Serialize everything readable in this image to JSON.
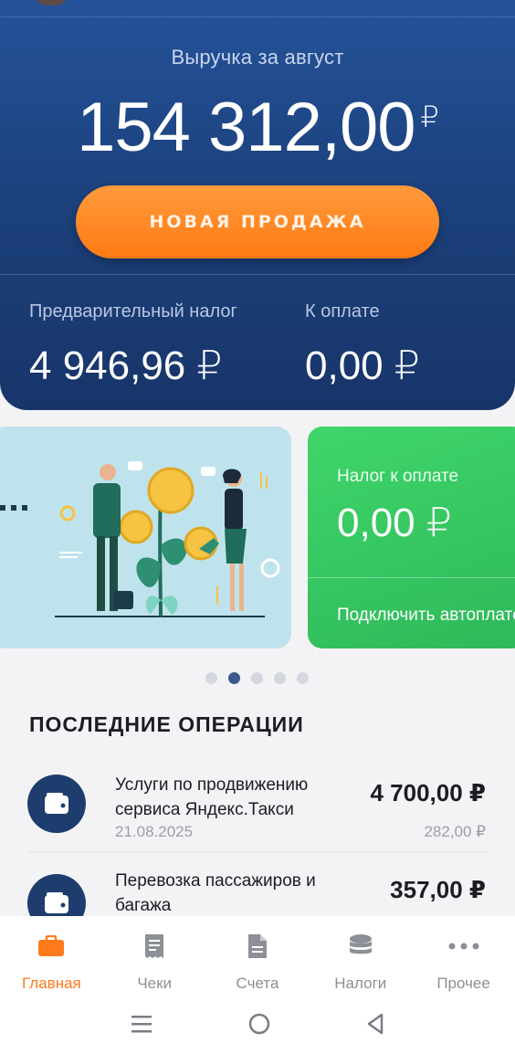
{
  "header": {
    "title": "Выручка за август",
    "amount": "154 312,00",
    "currency": "₽",
    "new_sale_button": "НОВАЯ ПРОДАЖА"
  },
  "taxes": {
    "preliminary_label": "Предварительный налог",
    "preliminary_value": "4 946,96 ₽",
    "to_pay_label": "К оплате",
    "to_pay_value": "0,00 ₽"
  },
  "carousel": {
    "green_card": {
      "label": "Налог к оплате",
      "amount": "0,00 ₽",
      "link": "Подключить автоплатёж"
    },
    "active_index": 1,
    "dot_count": 5
  },
  "operations": {
    "title": "ПОСЛЕДНИЕ ОПЕРАЦИИ",
    "items": [
      {
        "name": "Услуги по продвижению сервиса Яндекс.Такси",
        "date": "21.08.2025",
        "amount": "4 700,00 ₽",
        "tax": "282,00 ₽"
      },
      {
        "name": "Перевозка пассажиров и багажа",
        "amount": "357,00 ₽"
      }
    ]
  },
  "nav": [
    {
      "label": "Главная",
      "icon": "briefcase-icon",
      "active": true
    },
    {
      "label": "Чеки",
      "icon": "receipt-icon",
      "active": false
    },
    {
      "label": "Счета",
      "icon": "document-icon",
      "active": false
    },
    {
      "label": "Налоги",
      "icon": "coins-stack-icon",
      "active": false
    },
    {
      "label": "Прочее",
      "icon": "more-dots-icon",
      "active": false
    }
  ],
  "colors": {
    "hero_blue": "#1b3f79",
    "accent_orange": "#ff7b14",
    "green_card": "#35c260",
    "operation_icon_bg": "#1e3c6e"
  }
}
